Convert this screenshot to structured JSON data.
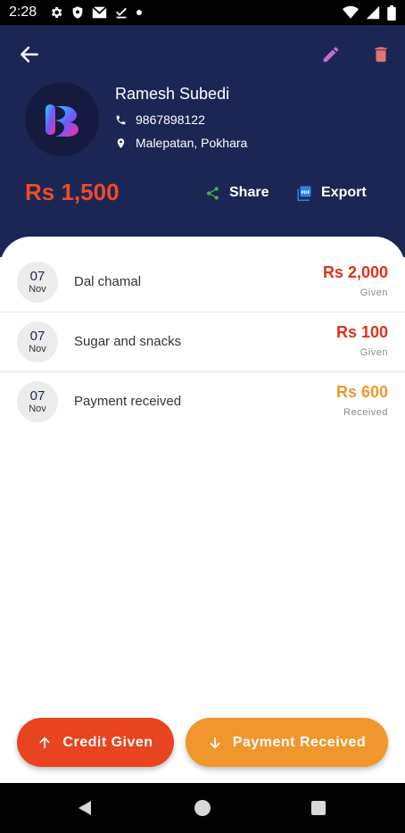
{
  "status_bar": {
    "time": "2:28",
    "left_icons": [
      "gear-icon",
      "shield-icon",
      "gmail-icon",
      "download-done-icon",
      "dot-icon"
    ],
    "right_icons": [
      "wifi-icon",
      "signal-icon",
      "battery-icon"
    ]
  },
  "header": {
    "back_icon": "arrow-left-icon",
    "edit_icon": "pencil-icon",
    "delete_icon": "trash-icon",
    "customer": {
      "name": "Ramesh Subedi",
      "phone": "9867898122",
      "address": "Malepatan, Pokhara"
    },
    "balance": "Rs 1,500",
    "share_label": "Share",
    "export_label": "Export"
  },
  "transactions": [
    {
      "day": "07",
      "month": "Nov",
      "description": "Dal chamal",
      "amount": "Rs 2,000",
      "type": "Given",
      "color": "#e0321c"
    },
    {
      "day": "07",
      "month": "Nov",
      "description": "Sugar and snacks",
      "amount": "Rs 100",
      "type": "Given",
      "color": "#e0321c"
    },
    {
      "day": "07",
      "month": "Nov",
      "description": "Payment received",
      "amount": "Rs 600",
      "type": "Received",
      "color": "#f0962c"
    }
  ],
  "actions": {
    "credit_label": "Credit Given",
    "payment_label": "Payment Received"
  },
  "colors": {
    "header_bg": "#1c2654",
    "balance": "#ef4a2c",
    "given": "#e0321c",
    "received": "#f0962c",
    "share_icon": "#4caf50",
    "export_icon": "#2f80ed",
    "edit_icon": "#c070d0",
    "delete_icon": "#e57373"
  }
}
